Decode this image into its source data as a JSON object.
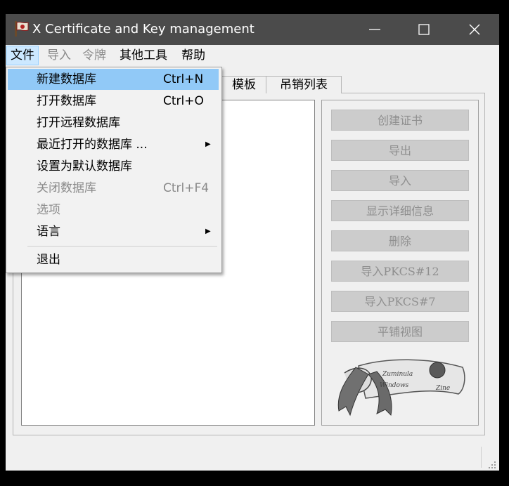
{
  "window": {
    "title": "X Certificate and Key management"
  },
  "menubar": {
    "items": [
      {
        "label": "文件"
      },
      {
        "label": "导入"
      },
      {
        "label": "令牌"
      },
      {
        "label": "其他工具"
      },
      {
        "label": "帮助"
      }
    ]
  },
  "tabs": [
    {
      "label": "模板"
    },
    {
      "label": "吊销列表"
    }
  ],
  "file_menu": {
    "items": [
      {
        "label": "新建数据库",
        "shortcut": "Ctrl+N"
      },
      {
        "label": "打开数据库",
        "shortcut": "Ctrl+O"
      },
      {
        "label": "打开远程数据库"
      },
      {
        "label": "最近打开的数据库 ..."
      },
      {
        "label": "设置为默认数据库"
      },
      {
        "label": "关闭数据库",
        "shortcut": "Ctrl+F4"
      },
      {
        "label": "选项"
      },
      {
        "label": "语言"
      },
      {
        "label": "退出"
      }
    ]
  },
  "actions": [
    {
      "label": "创建证书"
    },
    {
      "label": "导出"
    },
    {
      "label": "导入"
    },
    {
      "label": "显示详细信息"
    },
    {
      "label": "删除"
    },
    {
      "label": "导入PKCS#12"
    },
    {
      "label": "导入PKCS#7"
    },
    {
      "label": "平铺视图"
    }
  ],
  "banner": {
    "line1": "Zuminula",
    "line2": "Windows",
    "line3": "Zine"
  },
  "colors": {
    "titlebar": "#4b4b4b",
    "menu_highlight": "#91c9f7",
    "disabled_button": "#cccccc"
  }
}
